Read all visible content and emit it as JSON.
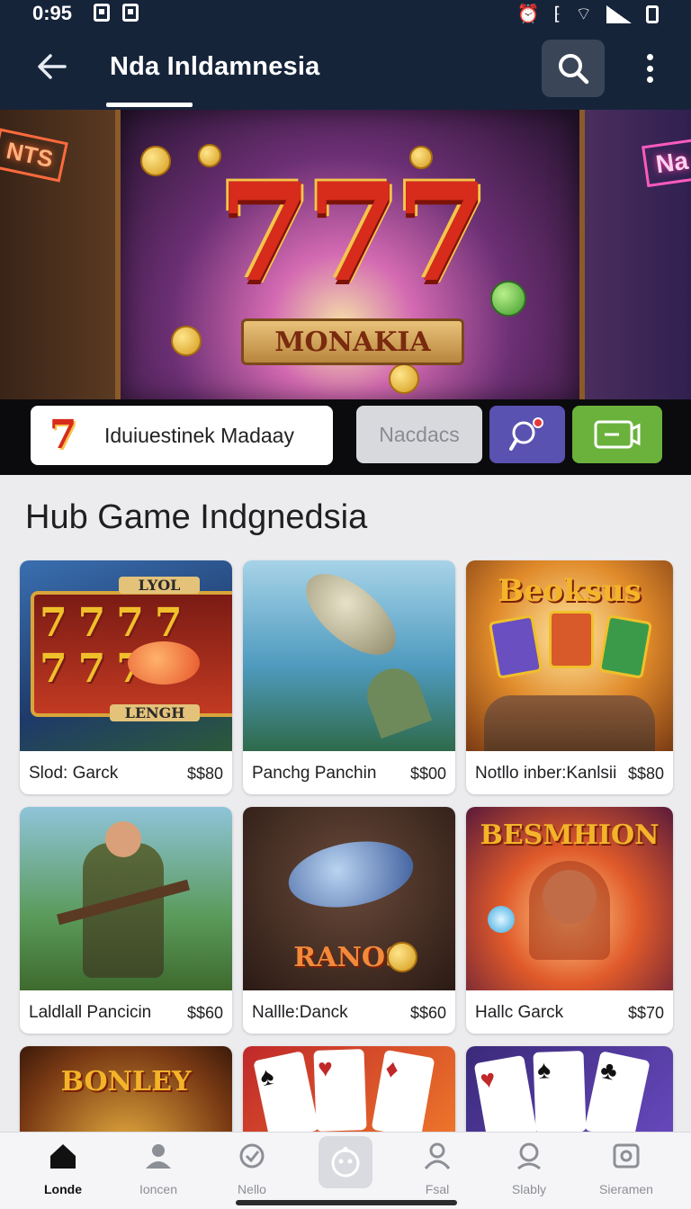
{
  "status": {
    "time": "0:95"
  },
  "appbar": {
    "title": "Nda Inldamnesia"
  },
  "hero": {
    "big_number": "777",
    "ribbon": "MONAKIA",
    "neon_left": "NTS",
    "neon_right": "Na"
  },
  "promo": {
    "logo_text": "7",
    "input_text": "Iduiuestinek Madaay",
    "button_grey": "Nacdacs"
  },
  "section": {
    "title": "Hub Game Indgnedsia"
  },
  "games": [
    {
      "name": "Slod: Garck",
      "price": "$$80",
      "art_title": "LYOL",
      "art_sub": "LENGH"
    },
    {
      "name": "Panchg Panchin",
      "price": "$$00"
    },
    {
      "name": "Notllo inber:Kanlsii",
      "price": "$$80",
      "art_title": "Beoksus"
    },
    {
      "name": "Laldlall Pancicin",
      "price": "$$60"
    },
    {
      "name": "Nallle:Danck",
      "price": "$$60",
      "art_title": "RANOS"
    },
    {
      "name": "Hallc Garck",
      "price": "$$70",
      "art_title": "BESMHION"
    },
    {
      "art_title": "BONLEY"
    },
    {},
    {}
  ],
  "nav": {
    "items": [
      {
        "label": "Londe",
        "icon": "home-icon"
      },
      {
        "label": "Ioncen",
        "icon": "person-icon"
      },
      {
        "label": "Nello",
        "icon": "badge-icon"
      },
      {
        "label": "",
        "icon": "face-icon"
      },
      {
        "label": "Fsal",
        "icon": "user-icon"
      },
      {
        "label": "Slably",
        "icon": "search-person-icon"
      },
      {
        "label": "Sieramen",
        "icon": "camera-icon"
      }
    ]
  },
  "colors": {
    "appbar": "#16243a",
    "accent_red": "#d72b1c",
    "gold": "#f3b429"
  }
}
